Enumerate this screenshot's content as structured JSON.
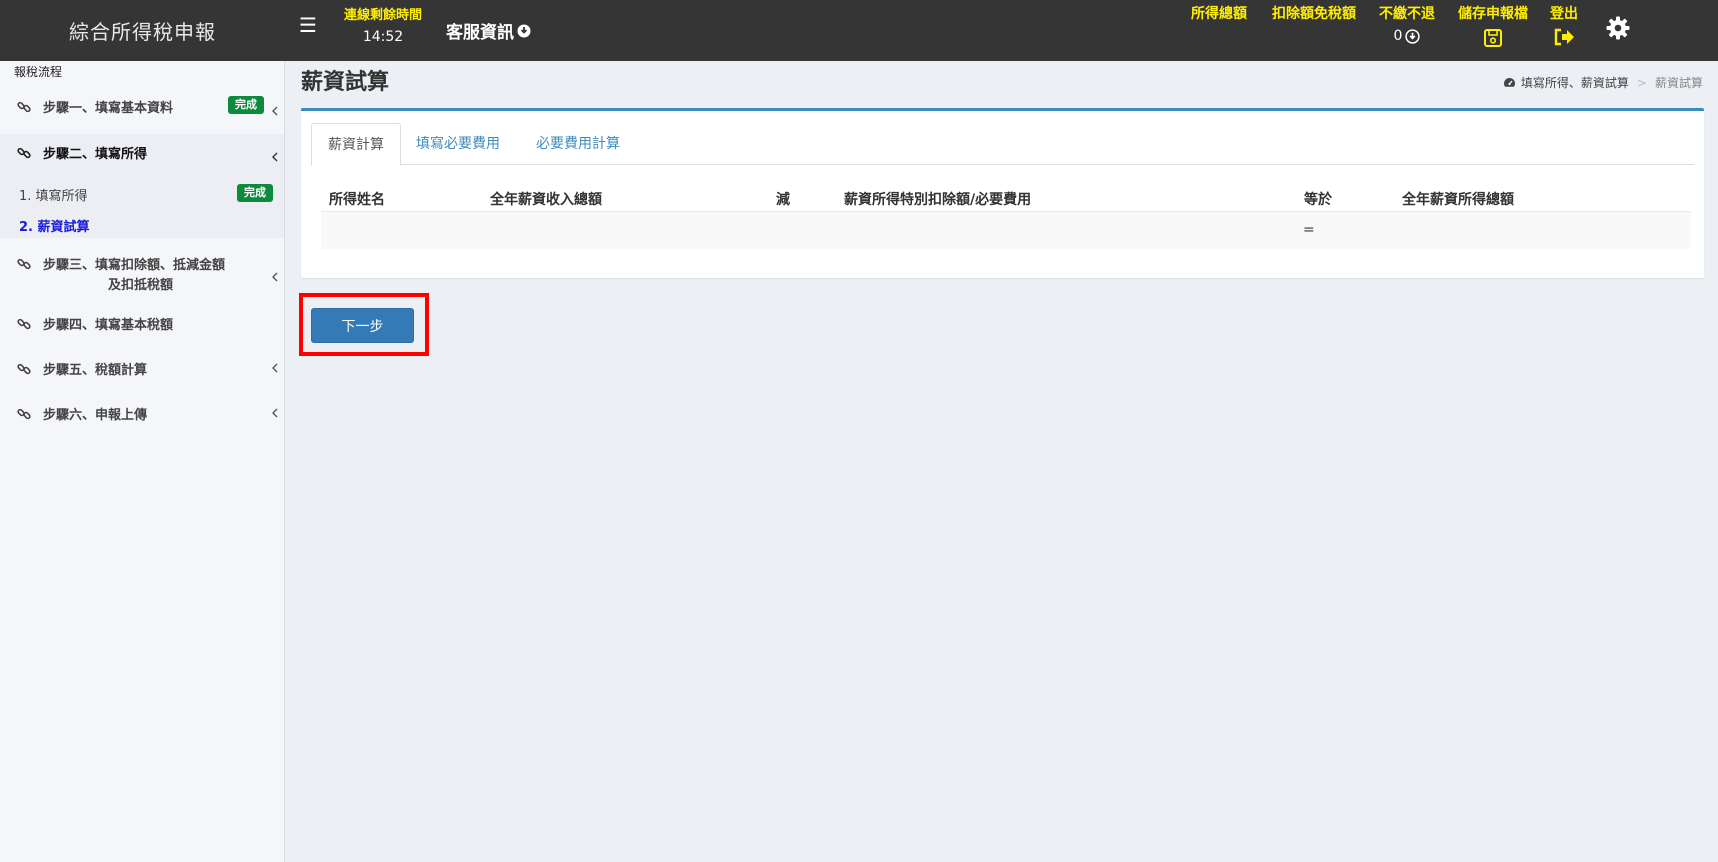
{
  "header": {
    "brand": "綜合所得稅申報",
    "timer_label": "連線剩餘時間",
    "timer_value": "14:52",
    "service_label": "客服資訊",
    "total_income_label": "所得總額",
    "deduction_label": "扣除額免稅額",
    "no_pay_label": "不繳不退",
    "no_pay_value": "0",
    "save_label": "儲存申報檔",
    "logout_label": "登出",
    "accent_color": "#ffee00"
  },
  "sidebar": {
    "heading": "報稅流程",
    "steps": [
      {
        "label": "步驟一、填寫基本資料",
        "badge": "完成"
      },
      {
        "label": "步驟二、填寫所得"
      },
      {
        "label_line1": "步驟三、填寫扣除額、抵減金額",
        "label_line2": "及扣抵稅額"
      },
      {
        "label": "步驟四、填寫基本稅額"
      },
      {
        "label": "步驟五、稅額計算"
      },
      {
        "label": "步驟六、申報上傳"
      }
    ],
    "sub_items": [
      {
        "label": "1. 填寫所得",
        "badge": "完成"
      },
      {
        "label": "2. 薪資試算"
      }
    ]
  },
  "page": {
    "title": "薪資試算",
    "breadcrumb": [
      "填寫所得、薪資試算",
      "薪資試算"
    ]
  },
  "tabs": [
    "薪資計算",
    "填寫必要費用",
    "必要費用計算"
  ],
  "table": {
    "headers": [
      "所得姓名",
      "全年薪資收入總額",
      "減",
      "薪資所得特別扣除額/必要費用",
      "等於",
      "全年薪資所得總額"
    ],
    "row": {
      "equals": "="
    }
  },
  "actions": {
    "next_label": "下一步"
  }
}
